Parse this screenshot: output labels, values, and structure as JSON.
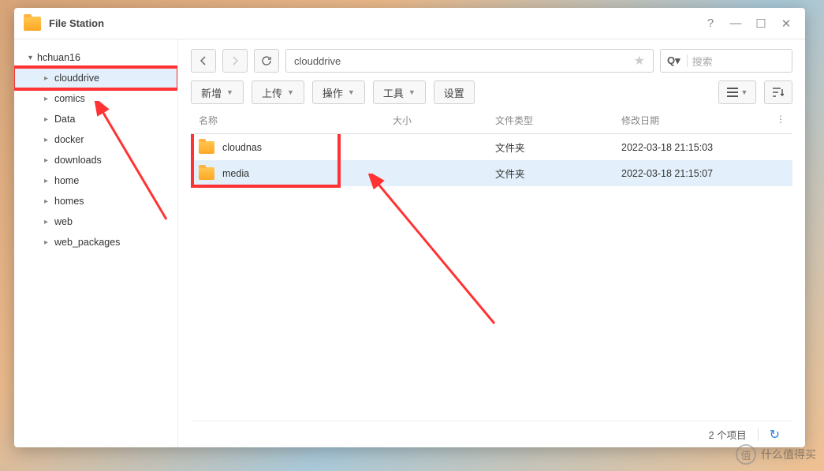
{
  "titlebar": {
    "title": "File Station"
  },
  "sidebar": {
    "root": "hchuan16",
    "items": [
      {
        "label": "clouddrive",
        "selected": true,
        "boxed": true
      },
      {
        "label": "comics"
      },
      {
        "label": "Data"
      },
      {
        "label": "docker"
      },
      {
        "label": "downloads"
      },
      {
        "label": "home"
      },
      {
        "label": "homes"
      },
      {
        "label": "web"
      },
      {
        "label": "web_packages"
      }
    ]
  },
  "toolbar": {
    "path": "clouddrive",
    "search_prefix": "Q▾",
    "search_placeholder": "搜索",
    "buttons": {
      "new": "新增",
      "upload": "上传",
      "action": "操作",
      "tools": "工具",
      "settings": "设置"
    }
  },
  "columns": {
    "name": "名称",
    "size": "大小",
    "type": "文件类型",
    "date": "修改日期"
  },
  "rows": [
    {
      "name": "cloudnas",
      "size": "",
      "type": "文件夹",
      "date": "2022-03-18 21:15:03",
      "selected": false
    },
    {
      "name": "media",
      "size": "",
      "type": "文件夹",
      "date": "2022-03-18 21:15:07",
      "selected": true
    }
  ],
  "status": {
    "count": "2 个项目"
  },
  "watermark": {
    "badge": "值",
    "text": "什么值得买"
  }
}
